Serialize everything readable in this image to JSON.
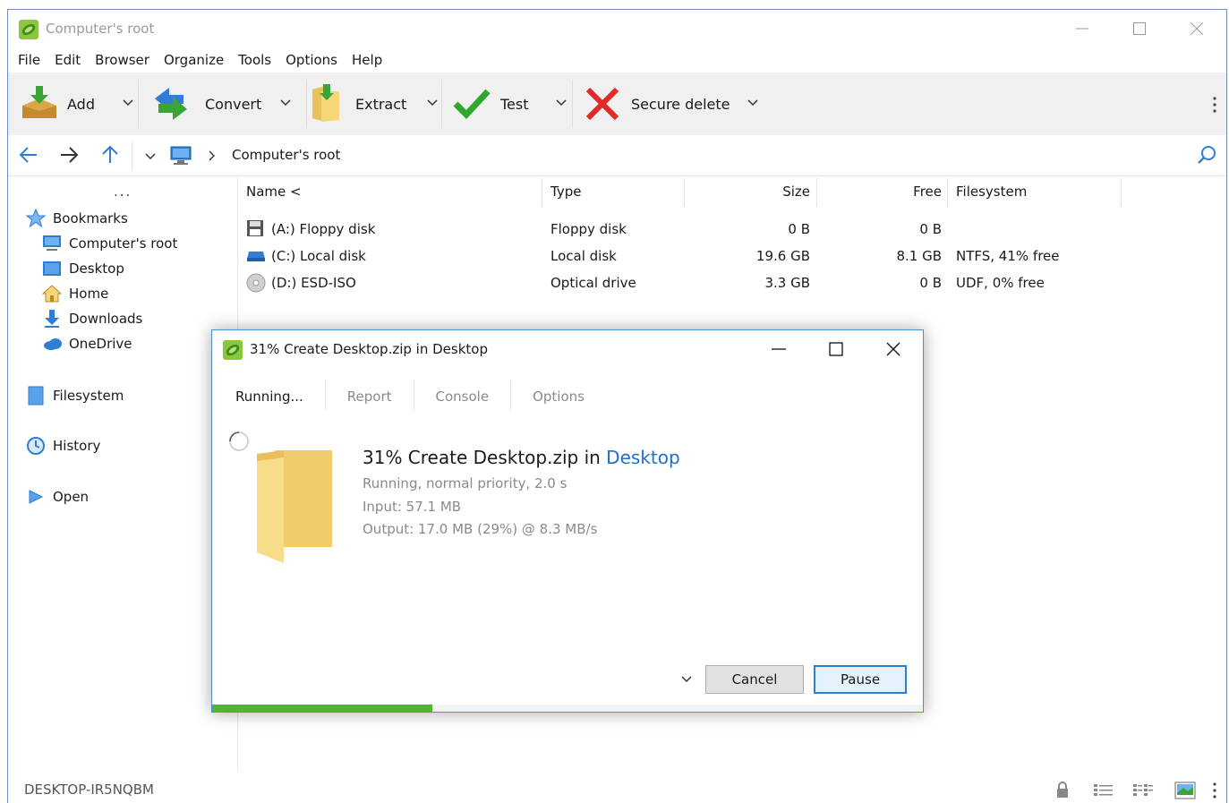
{
  "window": {
    "title": "Computer's root"
  },
  "menu": [
    "File",
    "Edit",
    "Browser",
    "Organize",
    "Tools",
    "Options",
    "Help"
  ],
  "toolbar": {
    "add": "Add",
    "convert": "Convert",
    "extract": "Extract",
    "test": "Test",
    "secure_delete": "Secure delete"
  },
  "address": {
    "crumb": "Computer's root"
  },
  "sidebar": {
    "more": "...",
    "bookmarks": "Bookmarks",
    "items": [
      "Computer's root",
      "Desktop",
      "Home",
      "Downloads",
      "OneDrive"
    ],
    "filesystem": "Filesystem",
    "history": "History",
    "open": "Open"
  },
  "table": {
    "headers": {
      "name": "Name <",
      "type": "Type",
      "size": "Size",
      "free": "Free",
      "filesystem": "Filesystem"
    },
    "rows": [
      {
        "name": "(A:) Floppy disk",
        "type": "Floppy disk",
        "size": "0 B",
        "free": "0 B",
        "fs": ""
      },
      {
        "name": "(C:) Local disk",
        "type": "Local disk",
        "size": "19.6 GB",
        "free": "8.1 GB",
        "fs": "NTFS, 41% free"
      },
      {
        "name": "(D:) ESD-ISO",
        "type": "Optical drive",
        "size": "3.3 GB",
        "free": "0 B",
        "fs": "UDF, 0% free"
      }
    ]
  },
  "status": {
    "computer": "DESKTOP-IR5NQBM"
  },
  "dialog": {
    "title": "31% Create Desktop.zip in Desktop",
    "tabs": [
      "Running...",
      "Report",
      "Console",
      "Options"
    ],
    "heading_prefix": "31% Create Desktop.zip in",
    "heading_link": "Desktop",
    "status_line": "Running, normal priority, 2.0 s",
    "input_line": "Input: 57.1 MB",
    "output_line": "Output: 17.0 MB (29%) @ 8.3 MB/s",
    "cancel": "Cancel",
    "pause": "Pause",
    "progress_percent": 31
  },
  "colors": {
    "accent": "#2f7dd4",
    "progress": "#52b52c",
    "link": "#1f6fd0"
  }
}
